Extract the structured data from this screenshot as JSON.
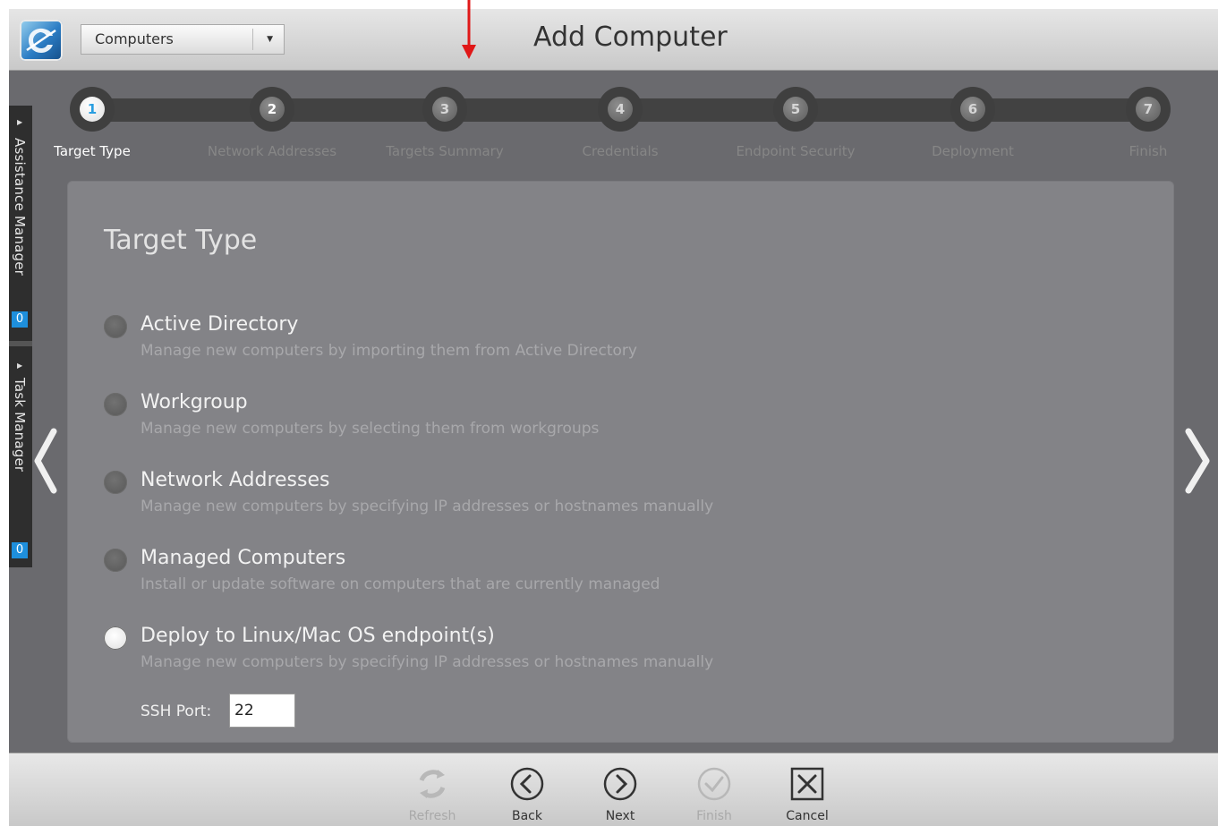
{
  "header": {
    "dropdown_value": "Computers",
    "title": "Add Computer"
  },
  "sidepanel": {
    "assistance_label": "Assistance Manager",
    "assistance_count": "0",
    "task_label": "Task Manager",
    "task_count": "0"
  },
  "steps": [
    {
      "num": "1",
      "label": "Target Type",
      "state": "active"
    },
    {
      "num": "2",
      "label": "Network Addresses",
      "state": "pending"
    },
    {
      "num": "3",
      "label": "Targets Summary",
      "state": "pending"
    },
    {
      "num": "4",
      "label": "Credentials",
      "state": "pending"
    },
    {
      "num": "5",
      "label": "Endpoint Security",
      "state": "pending"
    },
    {
      "num": "6",
      "label": "Deployment",
      "state": "pending"
    },
    {
      "num": "7",
      "label": "Finish",
      "state": "pending"
    }
  ],
  "panel": {
    "title": "Target Type",
    "options": [
      {
        "title": "Active Directory",
        "desc": "Manage new computers by importing them from Active Directory",
        "checked": false
      },
      {
        "title": "Workgroup",
        "desc": "Manage new computers by selecting them from workgroups",
        "checked": false
      },
      {
        "title": "Network Addresses",
        "desc": "Manage new computers by specifying IP addresses or hostnames manually",
        "checked": false
      },
      {
        "title": "Managed Computers",
        "desc": "Install or update software on computers that are currently managed",
        "checked": false
      },
      {
        "title": "Deploy to Linux/Mac OS endpoint(s)",
        "desc": "Manage new computers by specifying IP addresses or hostnames manually",
        "checked": true
      }
    ],
    "ssh_label": "SSH Port:",
    "ssh_value": "22"
  },
  "toolbar": {
    "refresh_label": "Refresh",
    "back_label": "Back",
    "next_label": "Next",
    "finish_label": "Finish",
    "cancel_label": "Cancel"
  },
  "colors": {
    "accent": "#2a9ee0",
    "arrow": "#e01818"
  }
}
